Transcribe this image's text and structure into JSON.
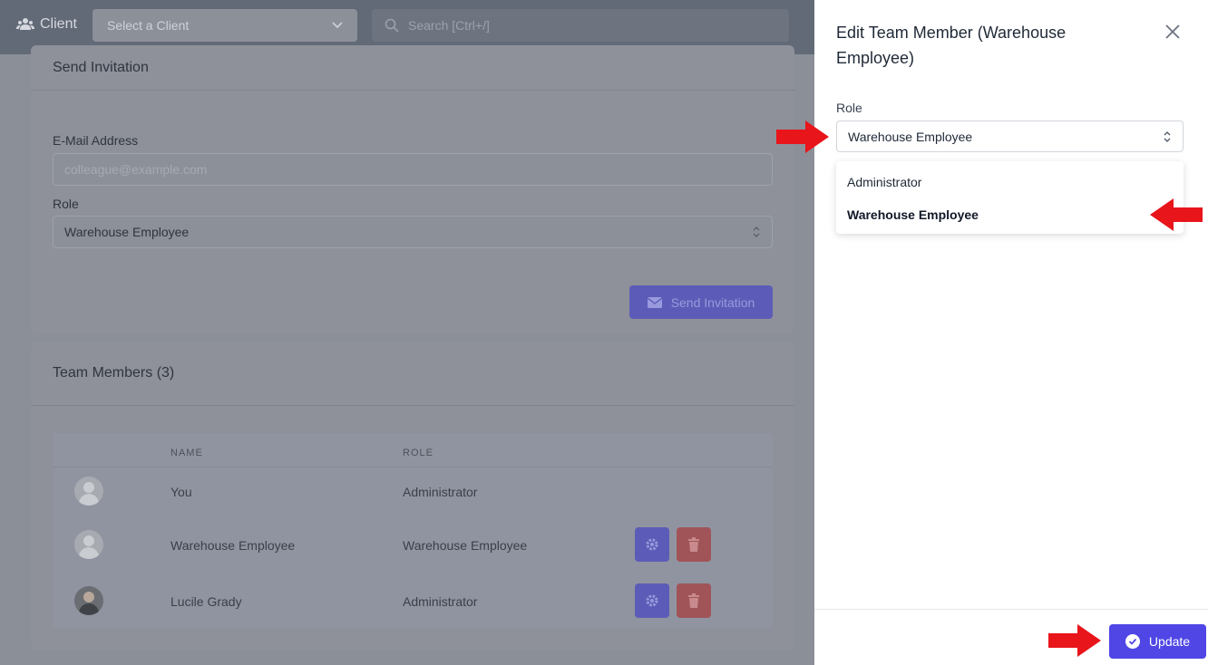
{
  "topbar": {
    "client_label": "Client",
    "client_select_placeholder": "Select a Client",
    "search_placeholder": "Search [Ctrl+/]"
  },
  "invitation": {
    "title": "Send Invitation",
    "email_label": "E-Mail Address",
    "email_placeholder": "colleague@example.com",
    "role_label": "Role",
    "role_value": "Warehouse Employee",
    "send_button": "Send Invitation"
  },
  "team": {
    "title": "Team Members (3)",
    "columns": [
      "NAME",
      "ROLE"
    ],
    "members": [
      {
        "name": "You",
        "role": "Administrator"
      },
      {
        "name": "Warehouse Employee",
        "role": "Warehouse Employee"
      },
      {
        "name": "Lucile Grady",
        "role": "Administrator"
      }
    ]
  },
  "panel": {
    "title": "Edit Team Member (Warehouse Employee)",
    "role_label": "Role",
    "role_value": "Warehouse Employee",
    "options": [
      "Administrator",
      "Warehouse Employee"
    ],
    "update_button": "Update"
  },
  "colors": {
    "primary": "#4f46e5",
    "danger": "#dc2626",
    "annotation_arrow": "#e8151b"
  }
}
